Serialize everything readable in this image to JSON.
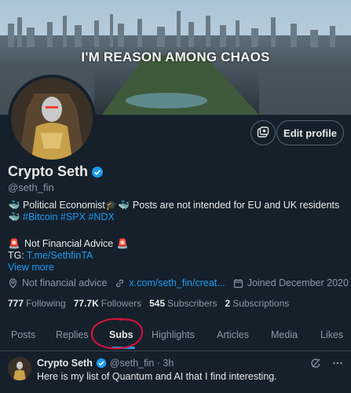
{
  "banner": {
    "text": "I'M REASON AMONG CHAOS"
  },
  "profile": {
    "display_name": "Crypto Seth",
    "handle": "@seth_fin",
    "edit_label": "Edit profile",
    "bio": {
      "line1_text": "Political Economist",
      "line1_text2": "Posts are not intended for EU and UK residents",
      "tags": "#Bitcoin #SPX #NDX",
      "disclaimer": "Not Financial Advice",
      "tg_label": "TG:",
      "tg_link": "T.me/SethfinTA",
      "view_more": "View more"
    },
    "meta": {
      "category": "Not financial advice",
      "website": "x.com/seth_fin/creat...",
      "joined": "Joined December 2020"
    },
    "stats": {
      "following_count": "777",
      "following_label": "Following",
      "followers_count": "77.7K",
      "followers_label": "Followers",
      "subscribers_count": "545",
      "subscribers_label": "Subscribers",
      "subscriptions_count": "2",
      "subscriptions_label": "Subscriptions"
    }
  },
  "tabs": [
    "Posts",
    "Replies",
    "Subs",
    "Highlights",
    "Articles",
    "Media",
    "Likes"
  ],
  "active_tab": "Subs",
  "tweet": {
    "name": "Crypto Seth",
    "handle_time": "@seth_fin · 3h",
    "text": "Here is my list of Quantum and AI that I find interesting."
  },
  "colors": {
    "background": "#15202b",
    "accent": "#1d9bf0",
    "muted": "#8b98a5",
    "annotation": "#c0148a"
  }
}
